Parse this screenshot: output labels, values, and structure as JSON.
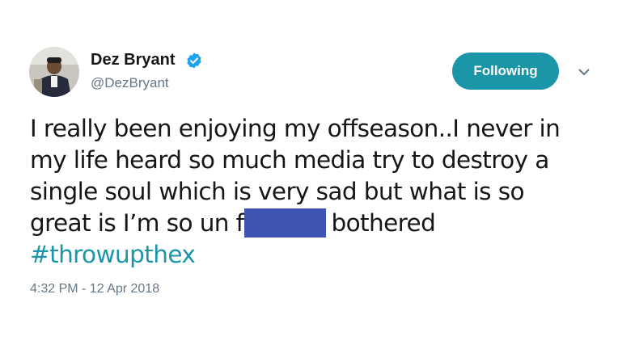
{
  "author": {
    "display_name": "Dez Bryant",
    "handle": "@DezBryant",
    "verified": true,
    "avatar_icon": "user-avatar"
  },
  "follow_button": {
    "label": "Following",
    "color": "#1b95a8"
  },
  "menu": {
    "icon": "chevron-down-icon"
  },
  "tweet": {
    "line1": "I really been enjoying my offseason..I never in",
    "line2": "my life heard so much media try to destroy a",
    "line3": "single soul which is very sad but what is so",
    "line4_before": "great is I’m so un f",
    "line4_after": "bothered",
    "hashtag": "#throwupthex",
    "redaction_color": "#3d55b0"
  },
  "timestamp": "4:32 PM - 12 Apr 2018",
  "colors": {
    "text": "#14171a",
    "secondary": "#657786",
    "accent": "#1b95a8",
    "verified": "#1da1f2"
  }
}
